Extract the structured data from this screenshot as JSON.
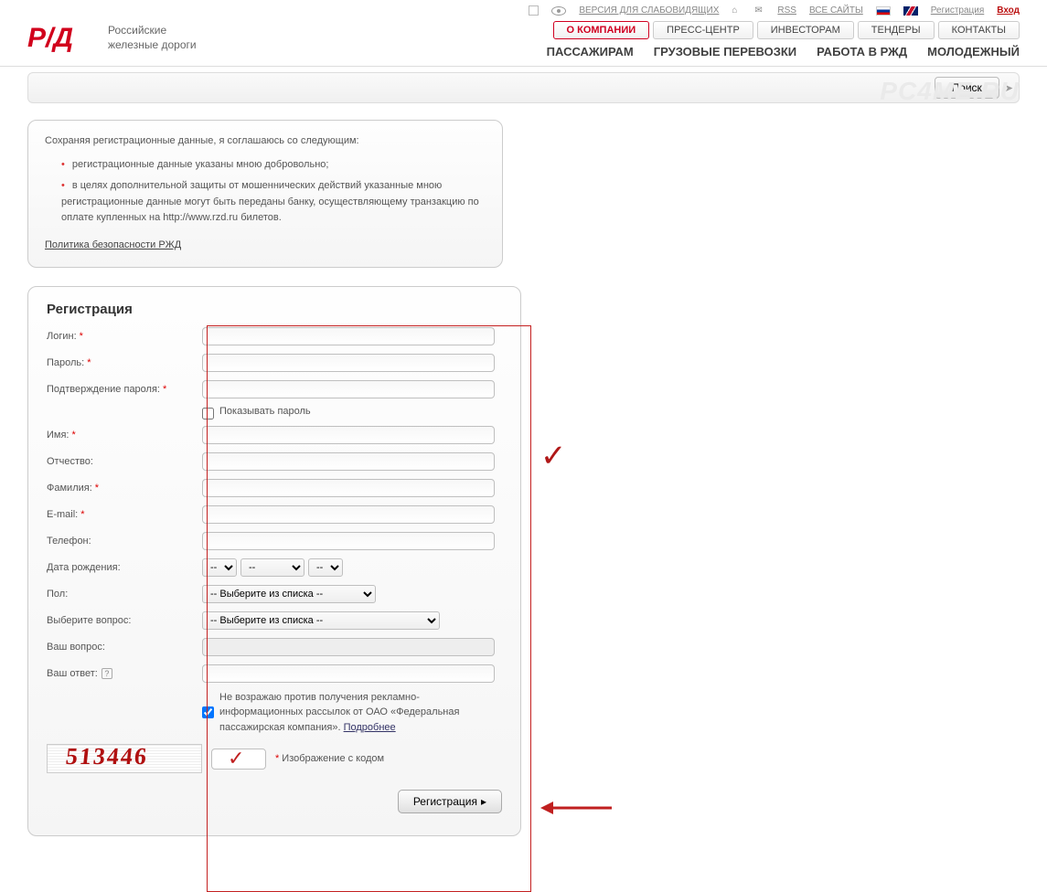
{
  "topbar": {
    "lowvision": "ВЕРСИЯ ДЛЯ СЛАБОВИДЯЩИХ",
    "rss": "RSS",
    "allsites": "ВСЕ САЙТЫ",
    "register": "Регистрация",
    "login": "Вход"
  },
  "brand": {
    "line1": "Российские",
    "line2": "железные дороги"
  },
  "nav1": {
    "about": "О КОМПАНИИ",
    "press": "ПРЕСС-ЦЕНТР",
    "investors": "ИНВЕСТОРАМ",
    "tenders": "ТЕНДЕРЫ",
    "contacts": "КОНТАКТЫ"
  },
  "nav2": {
    "passengers": "ПАССАЖИРАМ",
    "freight": "ГРУЗОВЫЕ ПЕРЕВОЗКИ",
    "jobs": "РАБОТА В РЖД",
    "youth": "МОЛОДЕЖНЫЙ"
  },
  "search": {
    "button": "Поиск"
  },
  "watermark": "PC4ME.RU",
  "consent": {
    "intro": "Сохраняя регистрационные данные, я соглашаюсь со следующим:",
    "li1": "регистрационные данные указаны мною добровольно;",
    "li2": "в целях дополнительной защиты от мошеннических действий указанные мною регистрационные данные могут быть переданы банку, осуществляющему транзакцию по оплате купленных на http://www.rzd.ru билетов.",
    "policy": "Политика безопасности РЖД"
  },
  "form": {
    "title": "Регистрация",
    "login": "Логин:",
    "password": "Пароль:",
    "password_confirm": "Подтверждение пароля:",
    "show_password": "Показывать пароль",
    "firstname": "Имя:",
    "middlename": "Отчество:",
    "lastname": "Фамилия:",
    "email": "E-mail:",
    "phone": "Телефон:",
    "dob": "Дата рождения:",
    "gender": "Пол:",
    "gender_placeholder": "-- Выберите из списка --",
    "question": "Выберите вопрос:",
    "question_placeholder": "-- Выберите из списка --",
    "your_question": "Ваш вопрос:",
    "your_answer": "Ваш ответ:",
    "marketing_consent": "Не возражаю против получения рекламно-информационных рассылок от ОАО «Федеральная пассажирская компания». ",
    "marketing_more": "Подробнее",
    "captcha_label": "Изображение с кодом",
    "captcha_value": "513446",
    "date_placeholder": "--",
    "submit": "Регистрация"
  }
}
